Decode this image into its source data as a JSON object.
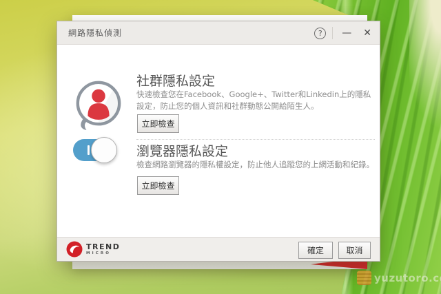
{
  "window": {
    "title": "網路隱私偵測",
    "controls": {
      "help": "?",
      "minimize": "—",
      "close": "✕"
    }
  },
  "sections": [
    {
      "icon": "social-profile-bubble-icon",
      "heading": "社群隱私設定",
      "description": "快速檢查您在Facebook、Google+、Twitter和Linkedin上的隱私設定，防止您的個人資訊和社群動態公開給陌生人。",
      "button": "立即檢查"
    },
    {
      "icon": "privacy-toggle-on-icon",
      "heading": "瀏覽器隱私設定",
      "description": "檢查網路瀏覽器的隱私權設定，防止他人追蹤您的上網活動和紀錄。",
      "button": "立即檢查"
    }
  ],
  "footer": {
    "brand": {
      "line1": "TREND",
      "line2": "MICRO"
    },
    "ok_label": "確定",
    "cancel_label": "取消"
  },
  "watermark": {
    "text": "yuzutoro.com"
  },
  "colors": {
    "brand_red": "#d22027",
    "person_red": "#db3840",
    "toggle_blue": "#539fcb",
    "titlebar_bg": "#edebe8",
    "footer_bg": "#f0eeeb",
    "leaf_green": "#60b122"
  }
}
